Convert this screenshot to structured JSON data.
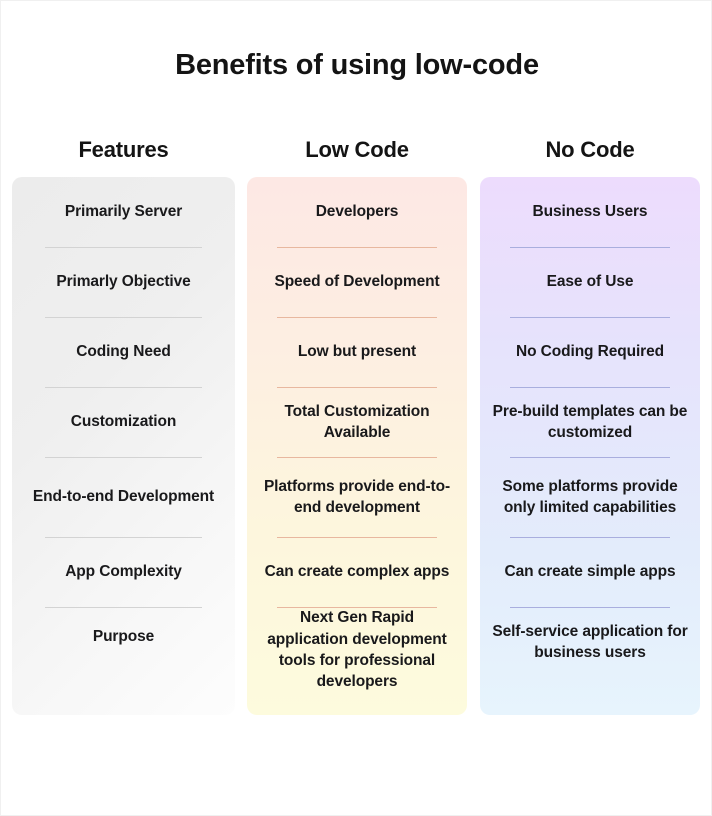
{
  "title": "Benefits of using low-code",
  "columns": [
    {
      "header": "Features",
      "accent": "#d3d3d3",
      "cells": [
        "Primarily Server",
        "Primarly Objective",
        "Coding Need",
        "Customization",
        "End-to-end Development",
        "App Complexity",
        "Purpose"
      ]
    },
    {
      "header": "Low Code",
      "accent": "#e8b79f",
      "cells": [
        "Developers",
        "Speed of Development",
        "Low but present",
        "Total Customization Available",
        "Platforms provide end-to-end development",
        "Can create complex apps",
        "Next Gen Rapid application development tools for professional developers"
      ]
    },
    {
      "header": "No Code",
      "accent": "#a9aede",
      "cells": [
        "Business Users",
        "Ease of Use",
        "No Coding Required",
        "Pre-build templates can be customized",
        "Some platforms provide only limited capabilities",
        "Can create simple apps",
        "Self-service application for business users"
      ]
    }
  ]
}
